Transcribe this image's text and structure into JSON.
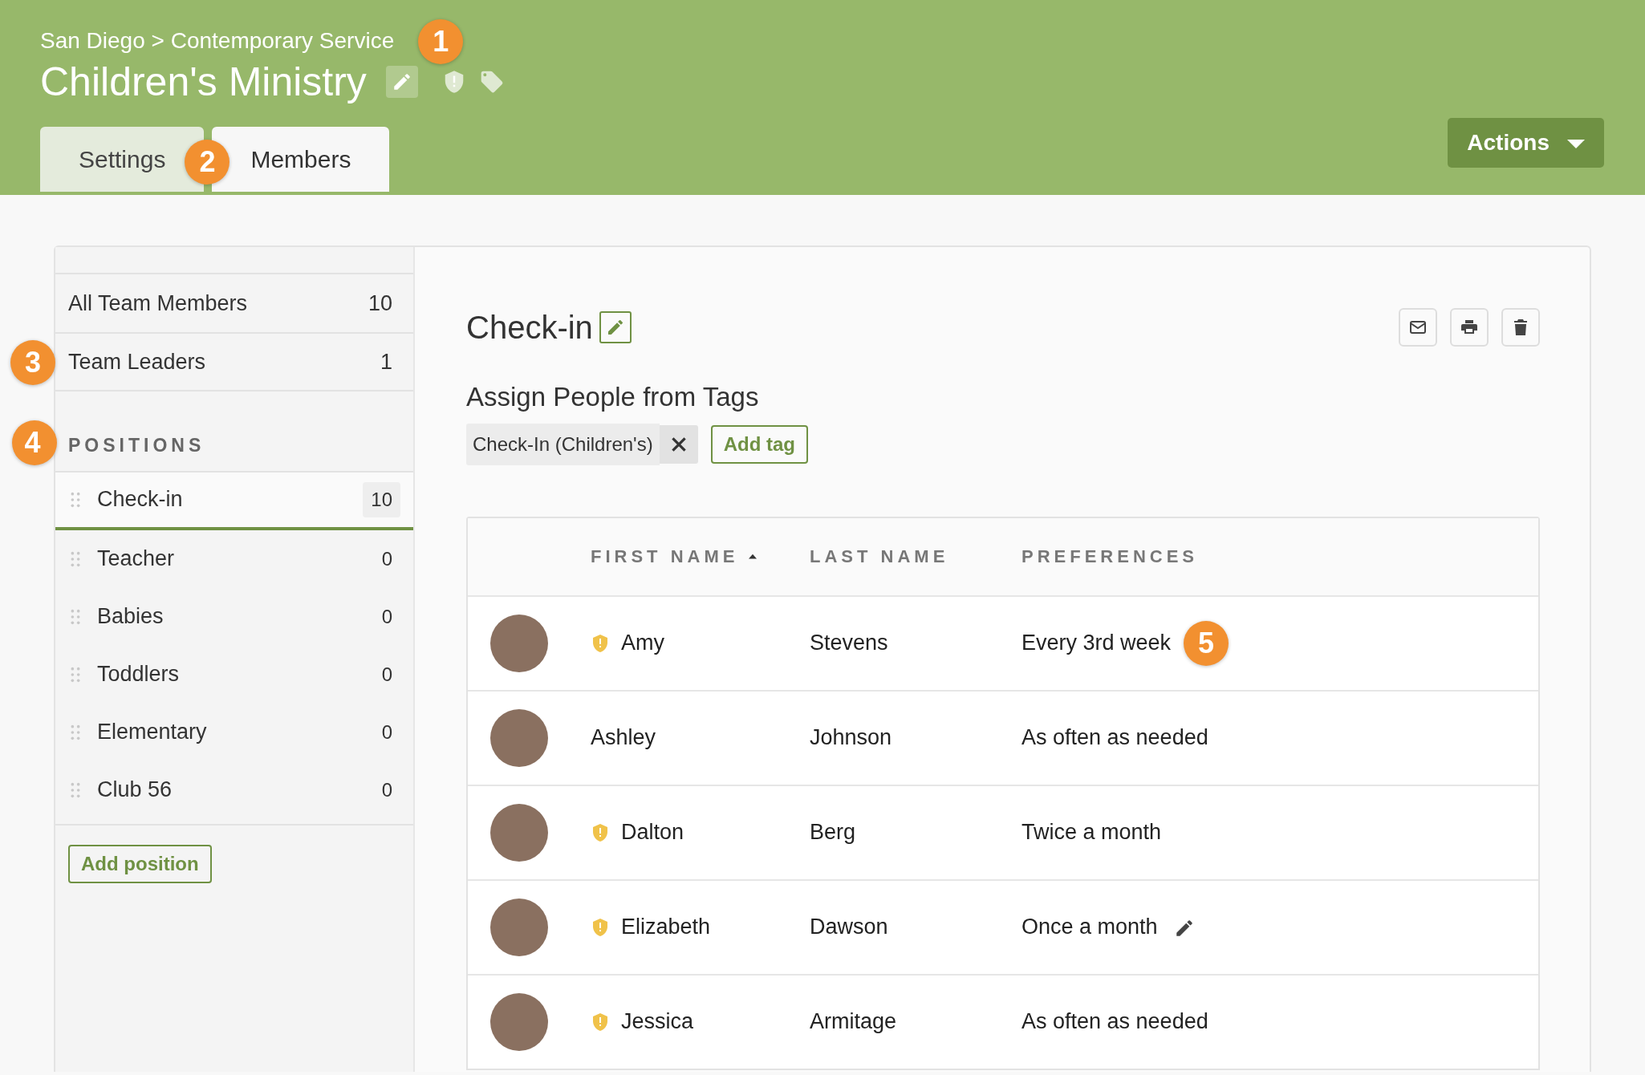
{
  "header": {
    "breadcrumb": "San Diego > Contemporary Service",
    "breadcrumb_callout": "1",
    "title": "Children's Ministry",
    "actions_label": "Actions"
  },
  "tabs": [
    {
      "label": "Settings",
      "selected": false,
      "callout": "2"
    },
    {
      "label": "Members",
      "selected": true
    }
  ],
  "sidebar": {
    "groups": [
      {
        "label": "All Team Members",
        "count": "10"
      },
      {
        "label": "Team Leaders",
        "count": "1",
        "callout": "3"
      }
    ],
    "positions_heading": "POSITIONS",
    "positions_callout": "4",
    "positions": [
      {
        "label": "Check-in",
        "count": "10",
        "selected": true
      },
      {
        "label": "Teacher",
        "count": "0",
        "selected": false
      },
      {
        "label": "Babies",
        "count": "0",
        "selected": false
      },
      {
        "label": "Toddlers",
        "count": "0",
        "selected": false
      },
      {
        "label": "Elementary",
        "count": "0",
        "selected": false
      },
      {
        "label": "Club 56",
        "count": "0",
        "selected": false
      }
    ],
    "add_position": "Add position"
  },
  "position": {
    "title": "Check-in",
    "tags_heading": "Assign People from Tags",
    "tags": [
      "Check-In (Children's)"
    ],
    "add_tag": "Add tag"
  },
  "table": {
    "columns": [
      {
        "label": "FIRST NAME",
        "sort_ascending": true
      },
      {
        "label": "LAST NAME"
      },
      {
        "label": "PREFERENCES"
      }
    ],
    "rows": [
      {
        "first": "Amy",
        "last": "Stevens",
        "preference": "Every 3rd week",
        "leader": true,
        "editing": false,
        "callout": "5"
      },
      {
        "first": "Ashley",
        "last": "Johnson",
        "preference": "As often as needed",
        "leader": false,
        "editing": false
      },
      {
        "first": "Dalton",
        "last": "Berg",
        "preference": "Twice a month",
        "leader": true,
        "editing": false
      },
      {
        "first": "Elizabeth",
        "last": "Dawson",
        "preference": "Once a month",
        "leader": true,
        "editing": true
      },
      {
        "first": "Jessica",
        "last": "Armitage",
        "preference": "As often as needed",
        "leader": true,
        "editing": false
      }
    ]
  }
}
